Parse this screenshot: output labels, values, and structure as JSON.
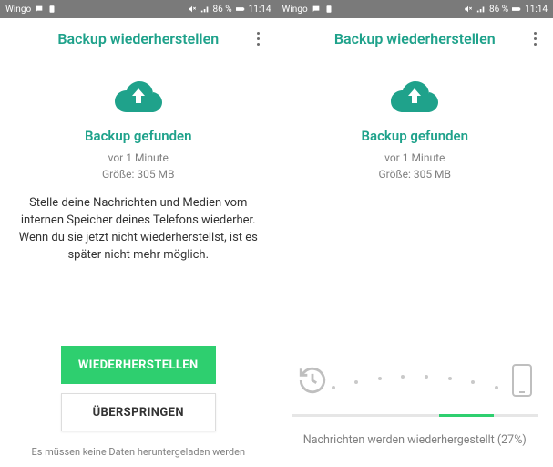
{
  "statusbar": {
    "carrier": "Wingo",
    "battery": "86 %",
    "time": "11:14"
  },
  "left": {
    "title": "Backup wiederherstellen",
    "found": "Backup gefunden",
    "time_ago": "vor 1 Minute",
    "size": "Größe: 305 MB",
    "description": "Stelle deine Nachrichten und Medien vom internen Speicher deines Telefons wiederher. Wenn du sie jetzt nicht wiederherstellst, ist es später nicht mehr möglich.",
    "restore_btn": "WIEDERHERSTELLEN",
    "skip_btn": "ÜBERSPRINGEN",
    "footnote": "Es müssen keine Daten heruntergeladen werden"
  },
  "right": {
    "title": "Backup wiederherstellen",
    "found": "Backup gefunden",
    "time_ago": "vor 1 Minute",
    "size": "Größe: 305 MB",
    "status": "Nachrichten werden wiederhergestellt (27%)",
    "progress_percent": 27,
    "bar_offset_percent": 60,
    "bar_width_percent": 22
  },
  "colors": {
    "teal": "#1fa28b",
    "green": "#2ecf6f"
  }
}
